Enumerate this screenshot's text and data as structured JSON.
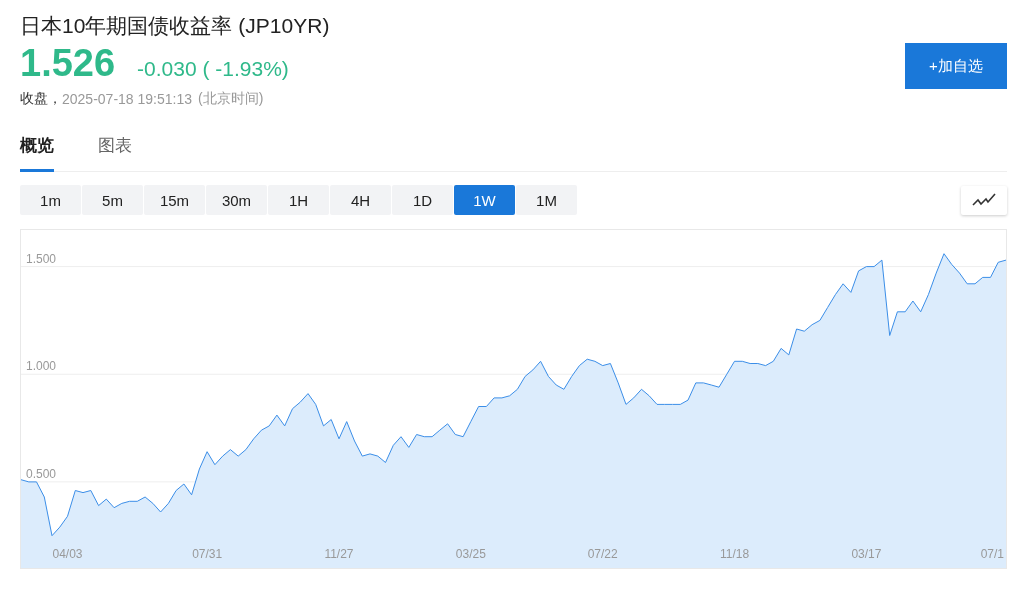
{
  "header": {
    "title": "日本10年期国债收益率",
    "symbol": "(JP10YR)",
    "price": "1.526",
    "change": "-0.030",
    "change_percent": "( -1.93%)",
    "status": "收盘，",
    "timestamp": "2025-07-18 19:51:13",
    "timezone": "(北京时间)",
    "add_button": "+加自选"
  },
  "tabs": [
    {
      "label": "概览",
      "selected": true
    },
    {
      "label": "图表",
      "selected": false
    }
  ],
  "intervals": [
    {
      "label": "1m",
      "selected": false
    },
    {
      "label": "5m",
      "selected": false
    },
    {
      "label": "15m",
      "selected": false
    },
    {
      "label": "30m",
      "selected": false
    },
    {
      "label": "1H",
      "selected": false
    },
    {
      "label": "4H",
      "selected": false
    },
    {
      "label": "1D",
      "selected": false
    },
    {
      "label": "1W",
      "selected": true
    },
    {
      "label": "1M",
      "selected": false
    }
  ],
  "chart_data": {
    "type": "area",
    "categories": [
      null,
      null,
      null,
      null,
      null,
      null,
      "04/03",
      null,
      null,
      null,
      null,
      null,
      null,
      null,
      null,
      null,
      null,
      null,
      null,
      null,
      null,
      null,
      null,
      null,
      "07/31",
      null,
      null,
      null,
      null,
      null,
      null,
      null,
      null,
      null,
      null,
      null,
      null,
      null,
      null,
      null,
      null,
      "11/27",
      null,
      null,
      null,
      null,
      null,
      null,
      null,
      null,
      null,
      null,
      null,
      null,
      null,
      null,
      null,
      null,
      "03/25",
      null,
      null,
      null,
      null,
      null,
      null,
      null,
      null,
      null,
      null,
      null,
      null,
      null,
      null,
      null,
      null,
      "07/22",
      null,
      null,
      null,
      null,
      null,
      null,
      null,
      null,
      null,
      null,
      null,
      null,
      null,
      null,
      null,
      null,
      "11/18",
      null,
      null,
      null,
      null,
      null,
      null,
      null,
      null,
      null,
      null,
      null,
      null,
      null,
      null,
      null,
      null,
      "03/17",
      null,
      null,
      null,
      null,
      null,
      null,
      null,
      null,
      null,
      null,
      null,
      null,
      null,
      null,
      null,
      null,
      "07/1",
      null
    ],
    "series": [
      {
        "color": "#3b8ee8",
        "values": [
          0.51,
          0.5,
          0.5,
          0.43,
          0.25,
          0.29,
          0.34,
          0.46,
          0.45,
          0.46,
          0.39,
          0.42,
          0.38,
          0.4,
          0.41,
          0.41,
          0.43,
          0.4,
          0.36,
          0.4,
          0.46,
          0.49,
          0.44,
          0.56,
          0.64,
          0.58,
          0.62,
          0.65,
          0.62,
          0.65,
          0.7,
          0.74,
          0.76,
          0.81,
          0.76,
          0.84,
          0.87,
          0.91,
          0.86,
          0.76,
          0.79,
          0.7,
          0.78,
          0.69,
          0.62,
          0.63,
          0.62,
          0.59,
          0.67,
          0.71,
          0.66,
          0.72,
          0.71,
          0.71,
          0.74,
          0.77,
          0.72,
          0.71,
          0.78,
          0.85,
          0.85,
          0.89,
          0.89,
          0.9,
          0.93,
          0.99,
          1.02,
          1.06,
          0.99,
          0.95,
          0.93,
          0.99,
          1.04,
          1.07,
          1.06,
          1.04,
          1.05,
          0.96,
          0.86,
          0.89,
          0.93,
          0.9,
          0.86,
          0.86,
          0.86,
          0.86,
          0.88,
          0.96,
          0.96,
          0.95,
          0.94,
          1.0,
          1.06,
          1.06,
          1.05,
          1.05,
          1.04,
          1.06,
          1.12,
          1.09,
          1.21,
          1.2,
          1.23,
          1.25,
          1.31,
          1.37,
          1.42,
          1.38,
          1.48,
          1.5,
          1.5,
          1.53,
          1.18,
          1.29,
          1.29,
          1.34,
          1.29,
          1.37,
          1.47,
          1.56,
          1.51,
          1.47,
          1.42,
          1.42,
          1.45,
          1.45,
          1.52,
          1.53
        ]
      }
    ],
    "ylim": [
      0.1,
      1.67
    ],
    "grid": true,
    "yticks": [
      {
        "value": 0.5,
        "label": "0.500"
      },
      {
        "value": 1.0,
        "label": "1.000"
      },
      {
        "value": 1.5,
        "label": "1.500"
      }
    ]
  }
}
